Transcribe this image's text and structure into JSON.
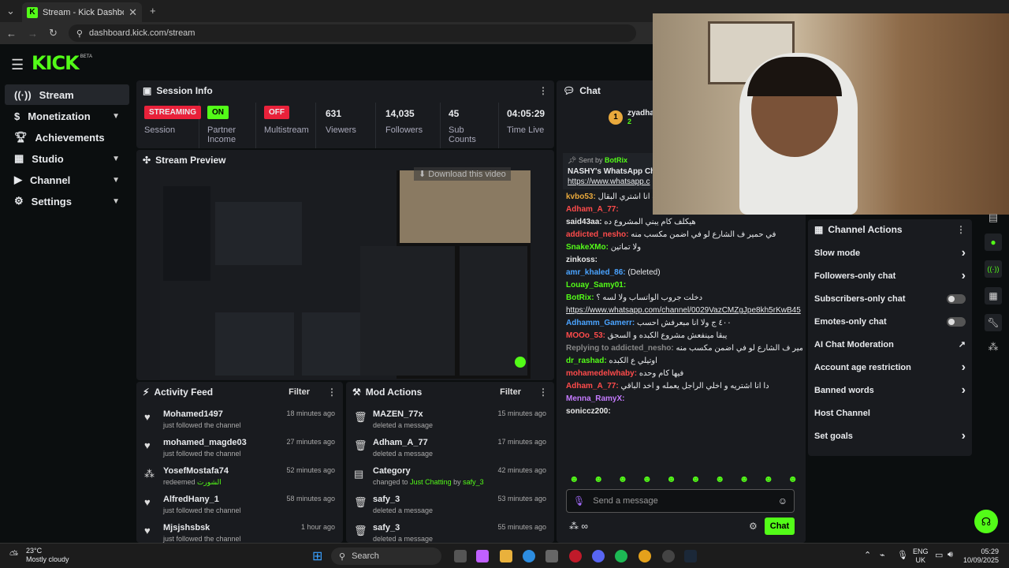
{
  "browser": {
    "tab_title": "Stream - Kick Dashboard",
    "url": "dashboard.kick.com/stream"
  },
  "app": {
    "logo": "KICK",
    "logo_badge": "BETA"
  },
  "sidebar": {
    "items": [
      {
        "label": "Stream",
        "icon": "broadcast-icon"
      },
      {
        "label": "Monetization",
        "icon": "dollar-icon"
      },
      {
        "label": "Achievements",
        "icon": "trophy-icon"
      },
      {
        "label": "Studio",
        "icon": "grid-icon"
      },
      {
        "label": "Channel",
        "icon": "video-icon"
      },
      {
        "label": "Settings",
        "icon": "gear-icon"
      }
    ]
  },
  "session": {
    "title": "Session Info",
    "status_pill": "STREAMING",
    "status_label": "Session",
    "partner_pill": "ON",
    "partner_label": "Partner Income",
    "multi_pill": "OFF",
    "multi_label": "Multistream",
    "viewers": "631",
    "viewers_label": "Viewers",
    "followers": "14,035",
    "followers_label": "Followers",
    "subs": "45",
    "subs_label": "Sub Counts",
    "time": "04:05:29",
    "time_label": "Time Live"
  },
  "preview": {
    "title": "Stream Preview",
    "download_label": "Download this video"
  },
  "activity": {
    "title": "Activity Feed",
    "filter": "Filter",
    "items": [
      {
        "name": "Mohamed1497",
        "action": "just followed the channel",
        "time": "18 minutes ago"
      },
      {
        "name": "mohamed_magde03",
        "action": "just followed the channel",
        "time": "27 minutes ago"
      },
      {
        "name": "YosefMostafa74",
        "action": "redeemed",
        "extra": "الشورت",
        "time": "52 minutes ago"
      },
      {
        "name": "AlfredHany_1",
        "action": "just followed the channel",
        "time": "58 minutes ago"
      },
      {
        "name": "Mjsjshsbsk",
        "action": "just followed the channel",
        "time": "1 hour ago"
      }
    ]
  },
  "mod": {
    "title": "Mod Actions",
    "filter": "Filter",
    "items": [
      {
        "name": "MAZEN_77x",
        "action": "deleted a message",
        "time": "15 minutes ago"
      },
      {
        "name": "Adham_A_77",
        "action": "deleted a message",
        "time": "17 minutes ago"
      },
      {
        "name": "Category",
        "action": "changed to",
        "category": "Just Chatting",
        "by": "by",
        "user": "safy_3",
        "time": "42 minutes ago"
      },
      {
        "name": "safy_3",
        "action": "deleted a message",
        "time": "53 minutes ago"
      },
      {
        "name": "safy_3",
        "action": "deleted a message",
        "time": "55 minutes ago"
      }
    ]
  },
  "chat": {
    "title": "Chat",
    "top_user": "zyadhar",
    "top_rank": "1",
    "top_count": "2",
    "pinned_by": "Sent by",
    "pinned_user": "BotRix",
    "pinned_text": "NASHY's WhatsApp Cha",
    "pinned_link": "https://www.whatsapp.c",
    "lines": [
      {
        "user": "kvbo53:",
        "color": "#e9a93c",
        "text": "ده انا اشتري البقال"
      },
      {
        "user": "Adham_A_77:",
        "color": "#ff4b4b",
        "text": ""
      },
      {
        "user": "said43aa:",
        "color": "#e8e8e8",
        "text": "هيكلف كام يبني المشروع ده"
      },
      {
        "user": "addicted_nesho:",
        "color": "#ff4b4b",
        "text": "في حمير ف الشارع لو في اضمن مكسب منه"
      },
      {
        "user": "SnakeXMo:",
        "color": "#53fc18",
        "text": "ولا تماتين"
      },
      {
        "user": "zinkoss:",
        "color": "#e8e8e8",
        "text": ""
      },
      {
        "user": "amr_khaled_86:",
        "color": "#4aa3ff",
        "text": "(Deleted)"
      },
      {
        "user": "Louay_Samy01:",
        "color": "#53fc18",
        "text": ""
      },
      {
        "user": "BotRix:",
        "color": "#53fc18",
        "text": "دخلت جروب الواتساب ولا لسه ؟"
      },
      {
        "user": "",
        "color": "#e8e8e8",
        "text": "https://www.whatsapp.com/channel/0029VazCMZgJpe8kh5rKwB45"
      },
      {
        "user": "Adhamm_Gamerr:",
        "color": "#4aa3ff",
        "text": "٤٠٠ ج ولا انا مبعرفش احسب"
      },
      {
        "user": "MOOo_53:",
        "color": "#ff4b4b",
        "text": "يبقا مينفعش مشروع الكبده و السجق"
      },
      {
        "user": "Replying to addicted_nesho:",
        "color": "#888",
        "text": "في حمير ف الشارع لو في اضمن مكسب منه"
      },
      {
        "user": "dr_rashad:",
        "color": "#53fc18",
        "text": "اوتيلي ع الكبده"
      },
      {
        "user": "mohamedelwhaby:",
        "color": "#ff4b4b",
        "text": "فيها كام وحده"
      },
      {
        "user": "Adham_A_77:",
        "color": "#ff4b4b",
        "text": "دا انا اشتريه و اخلي الراجل يعمله و اخد الباقي"
      },
      {
        "user": "Menna_RamyX:",
        "color": "#c57bff",
        "text": ""
      },
      {
        "user": "soniccz200:",
        "color": "#e8e8e8",
        "text": ""
      }
    ],
    "input_placeholder": "Send a message",
    "send_label": "Chat"
  },
  "channel_actions": {
    "title": "Channel Actions",
    "items": [
      {
        "label": "Slow mode",
        "ctrl": "chevron"
      },
      {
        "label": "Followers-only chat",
        "ctrl": "chevron"
      },
      {
        "label": "Subscribers-only chat",
        "ctrl": "toggle"
      },
      {
        "label": "Emotes-only chat",
        "ctrl": "toggle"
      },
      {
        "label": "AI Chat Moderation",
        "ctrl": "external"
      },
      {
        "label": "Account age restriction",
        "ctrl": "chevron"
      },
      {
        "label": "Banned words",
        "ctrl": "chevron"
      },
      {
        "label": "Host Channel",
        "ctrl": "none"
      },
      {
        "label": "Set goals",
        "ctrl": "chevron"
      }
    ]
  },
  "taskbar": {
    "weather_temp": "23°C",
    "weather_desc": "Mostly cloudy",
    "search": "Search",
    "lang": "ENG",
    "region": "UK",
    "time": "05:29",
    "date": "10/09/2025"
  },
  "colors": {
    "brand": "#53fc18",
    "streaming": "#e9213a",
    "panel": "#191b1f"
  }
}
